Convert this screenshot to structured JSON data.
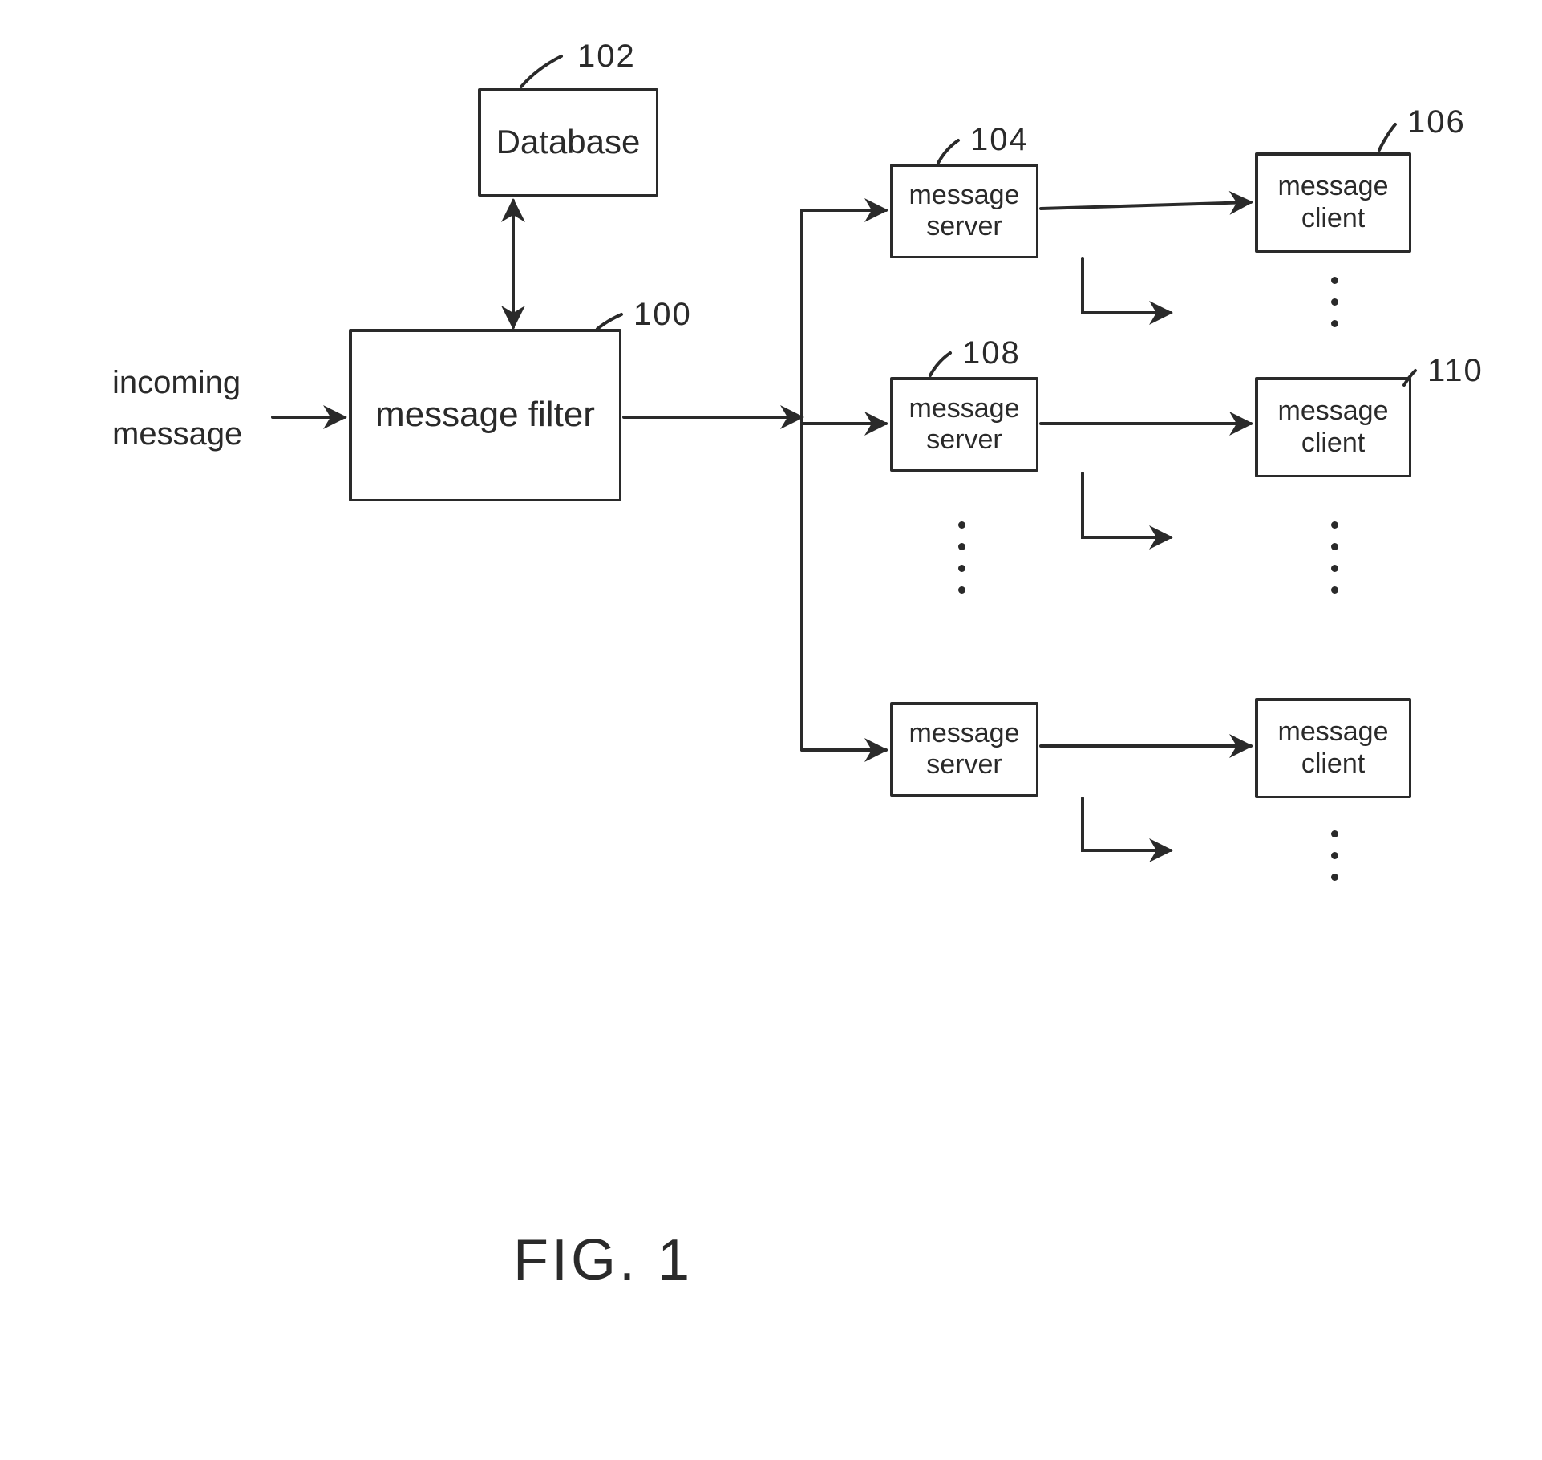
{
  "nodes": {
    "database": {
      "label": "Database",
      "ref": "102"
    },
    "filter": {
      "label": "message\nfilter",
      "ref": "100"
    },
    "server_a": {
      "label": "message\nserver",
      "ref": "104"
    },
    "server_b": {
      "label": "message\nserver",
      "ref": "108"
    },
    "server_c": {
      "label": "message\nserver",
      "ref": ""
    },
    "client_a": {
      "label": "message\nclient",
      "ref": "106"
    },
    "client_b": {
      "label": "message\nclient",
      "ref": "110"
    },
    "client_c": {
      "label": "message\nclient",
      "ref": ""
    }
  },
  "incoming_label": "incoming\nmessage",
  "figure_caption": "FIG.    1",
  "colors": {
    "ink": "#2a2a2a",
    "paper": "#ffffff"
  }
}
